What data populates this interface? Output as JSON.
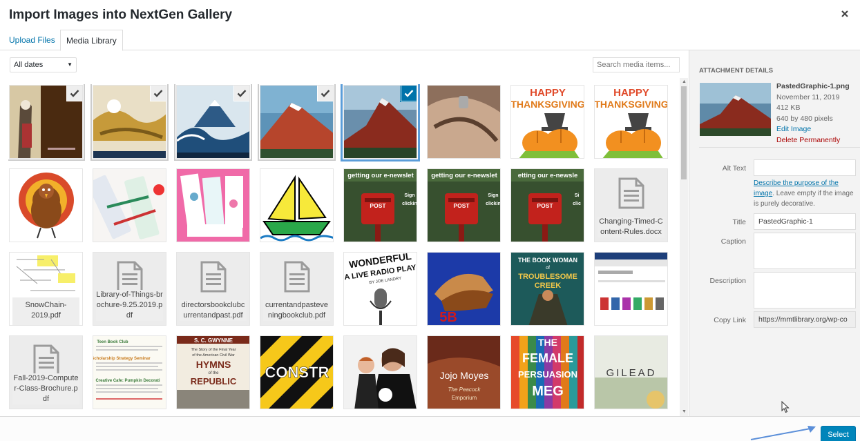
{
  "window": {
    "title": "Import Images into NextGen Gallery"
  },
  "tabs": [
    {
      "label": "Upload Files",
      "active": false
    },
    {
      "label": "Media Library",
      "active": true
    }
  ],
  "toolbar": {
    "date_filter": "All dates",
    "search_placeholder": "Search media items..."
  },
  "grid": {
    "items": [
      {
        "type": "image",
        "art": "geisha",
        "selected": true
      },
      {
        "type": "image",
        "art": "gold",
        "selected": true
      },
      {
        "type": "image",
        "art": "wave",
        "selected": true
      },
      {
        "type": "image",
        "art": "redfuji",
        "selected": true
      },
      {
        "type": "image",
        "art": "redfuji2",
        "selected": true,
        "active": true
      },
      {
        "type": "image",
        "art": "leather"
      },
      {
        "type": "image",
        "art": "happy",
        "text": [
          "HAPPY",
          "THANKSGIVING"
        ]
      },
      {
        "type": "image",
        "art": "happy",
        "text": [
          "HAPPY",
          "THANKSGIVING"
        ]
      },
      {
        "type": "image",
        "art": "turkey"
      },
      {
        "type": "image",
        "art": "pens"
      },
      {
        "type": "image",
        "art": "pinkbook"
      },
      {
        "type": "image",
        "art": "boat"
      },
      {
        "type": "image",
        "art": "post",
        "text": [
          "getting our e-newslet",
          "POST",
          "Sign",
          "clickin"
        ]
      },
      {
        "type": "image",
        "art": "post",
        "text": [
          "getting our e-newslet",
          "POST",
          "Sign",
          "clickin"
        ]
      },
      {
        "type": "image",
        "art": "post",
        "text": [
          "etting our e-newsle",
          "POST",
          "Si",
          "clic"
        ]
      },
      {
        "type": "document",
        "name": "Changing-Timed-Content-Rules.docx"
      },
      {
        "type": "document-preview",
        "name": "SnowChain-2019.pdf"
      },
      {
        "type": "document",
        "name": "Library-of-Things-brochure-9.25.2019.pdf"
      },
      {
        "type": "document",
        "name": "directorsbookclubcurrentandpast.pdf"
      },
      {
        "type": "document",
        "name": "currentandpasteveningbookclub.pdf"
      },
      {
        "type": "image",
        "art": "radio",
        "text": [
          "WONDERFUL",
          "A LIVE RADIO PLAY",
          "BY JOE LANDRY"
        ]
      },
      {
        "type": "image",
        "art": "hands",
        "text": [
          "5B"
        ]
      },
      {
        "type": "image",
        "art": "bookwoman",
        "text": [
          "THE BOOK WOMAN",
          "of",
          "TROUBLESOME",
          "CREEK"
        ]
      },
      {
        "type": "image",
        "art": "screenshot"
      },
      {
        "type": "document",
        "name": "Fall-2019-Computer-Class-Brochure.pdf"
      },
      {
        "type": "image",
        "art": "teenflyer",
        "text": [
          "Teen Book Club",
          "Scholarship Strategy Seminar",
          "Creative Cafe: Pumpkin Decorati"
        ]
      },
      {
        "type": "image",
        "art": "hymns",
        "text": [
          "S. C. GWYNNE",
          "The Story of the Final Year",
          "of the American Civil War",
          "HYMNS",
          "of the",
          "REPUBLIC"
        ]
      },
      {
        "type": "image",
        "art": "constr",
        "text": [
          "CONSTR"
        ]
      },
      {
        "type": "image",
        "art": "mother"
      },
      {
        "type": "image",
        "art": "peacock",
        "text": [
          "Jojo Moyes",
          "The Peacock",
          "Emporium"
        ]
      },
      {
        "type": "image",
        "art": "female",
        "text": [
          "THE",
          "FEMALE",
          "PERSUASION",
          "MEG"
        ]
      },
      {
        "type": "image",
        "art": "gilead",
        "text": [
          "GILEAD"
        ]
      }
    ]
  },
  "details": {
    "heading": "ATTACHMENT DETAILS",
    "filename": "PastedGraphic-1.png",
    "date": "November 11, 2019",
    "size": "412 KB",
    "dimensions": "640 by 480 pixels",
    "edit_link": "Edit Image",
    "delete_link": "Delete Permanently",
    "alt_label": "Alt Text",
    "alt_value": "",
    "alt_help_link": "Describe the purpose of the image",
    "alt_help_text": ". Leave empty if the image is purely decorative.",
    "title_label": "Title",
    "title_value": "PastedGraphic-1",
    "caption_label": "Caption",
    "caption_value": "",
    "description_label": "Description",
    "description_value": "",
    "copy_label": "Copy Link",
    "copy_value": "https://mmtlibrary.org/wp-co"
  },
  "footer": {
    "select_label": "Select"
  },
  "colors": {
    "accent": "#0073aa",
    "button": "#0085ba",
    "delete": "#aa0000"
  }
}
